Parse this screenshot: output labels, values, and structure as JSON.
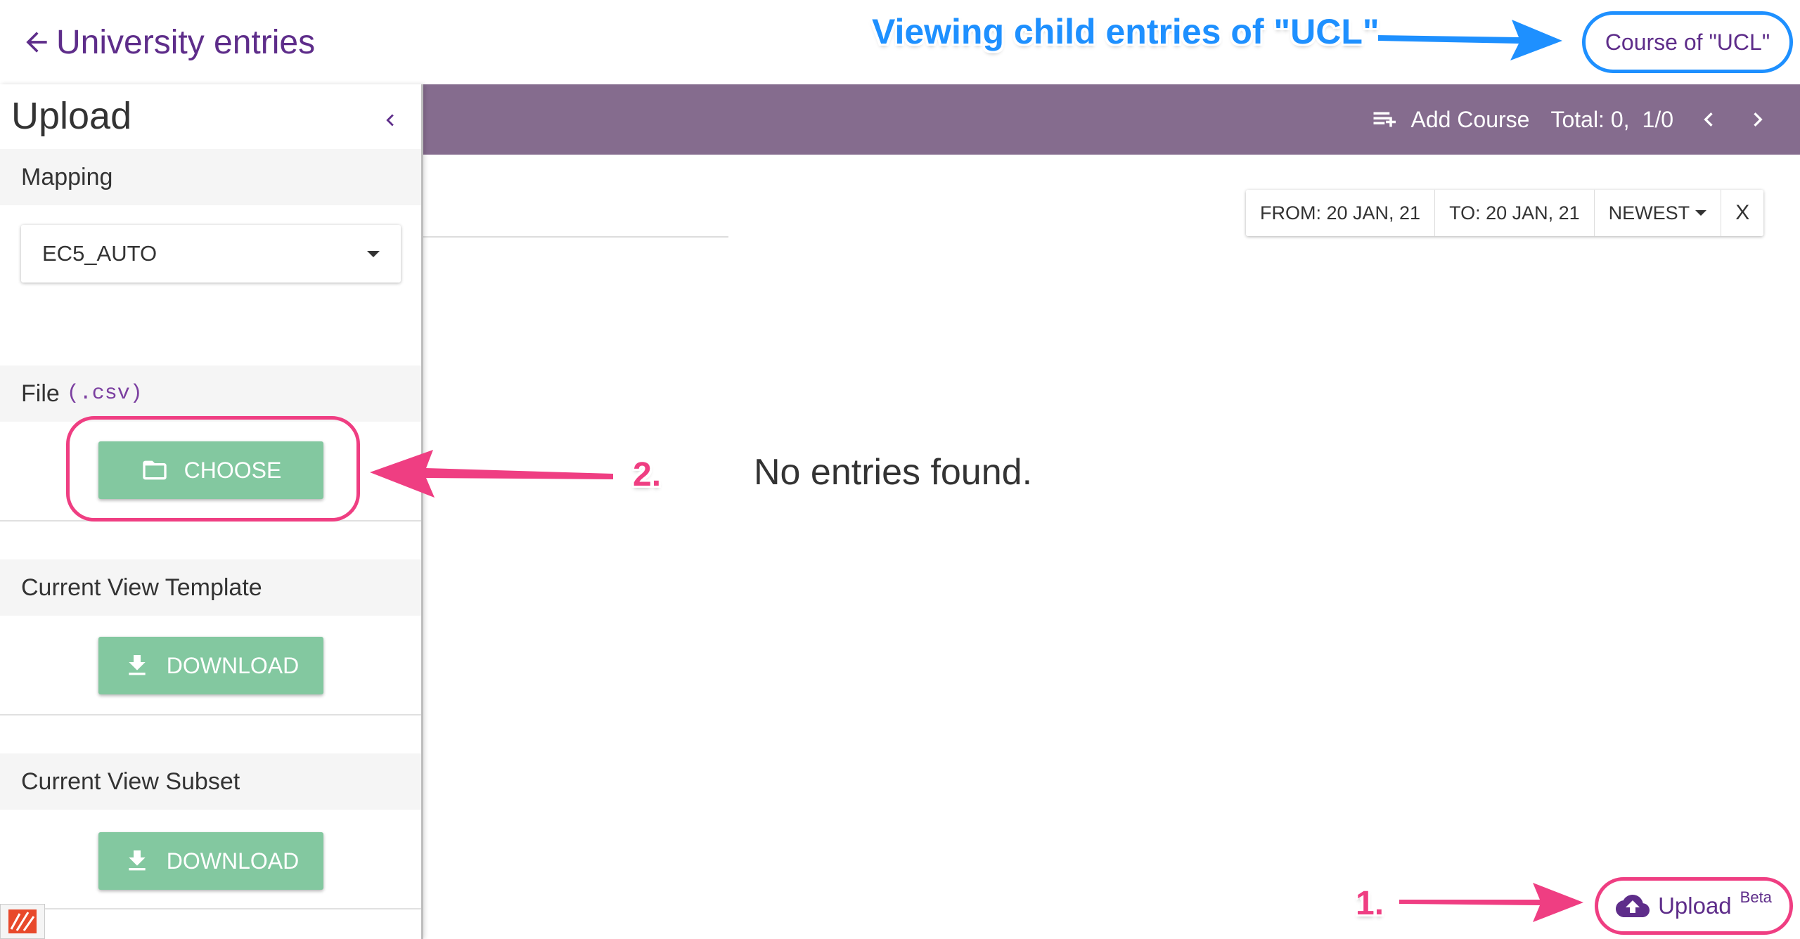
{
  "header": {
    "back_label": "University entries",
    "annotation_text": "Viewing child entries of \"UCL\"",
    "course_pill_label": "Course of \"UCL\""
  },
  "toolbar": {
    "add_label": "Add Course",
    "total_label": "Total: 0,",
    "page_label": "1/0"
  },
  "filters": {
    "from": "FROM: 20 JAN, 21",
    "to": "TO: 20 JAN, 21",
    "sort": "NEWEST",
    "clear": "X"
  },
  "main": {
    "empty_message": "No entries found."
  },
  "sidebar": {
    "title": "Upload",
    "mapping_header": "Mapping",
    "mapping_value": "EC5_AUTO",
    "file_header": "File",
    "file_ext": "(.csv)",
    "choose_label": "CHOOSE",
    "template_header": "Current View Template",
    "template_button": "DOWNLOAD",
    "subset_header": "Current View Subset",
    "subset_button": "DOWNLOAD"
  },
  "annotations": {
    "step1": "1.",
    "step2": "2."
  },
  "upload_fab": {
    "label": "Upload",
    "badge": "Beta"
  },
  "colors": {
    "accent_purple": "#5e2d8a",
    "toolbar": "#856c8e",
    "green_button": "#83c8a0",
    "annotation_blue": "#1e90ff",
    "annotation_pink": "#ef3e82"
  }
}
